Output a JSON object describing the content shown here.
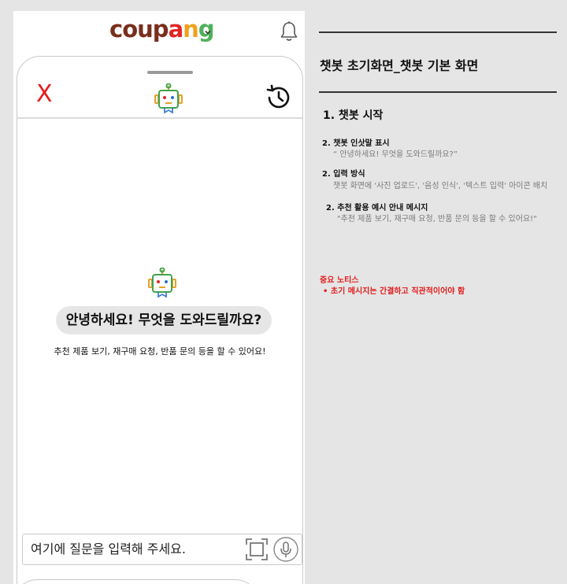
{
  "header": {
    "logo_letters": [
      "c",
      "o",
      "u",
      "p",
      "a",
      "n",
      "g"
    ],
    "logo_colors": [
      "#7a2e1d",
      "#7a2e1d",
      "#7a2e1d",
      "#7a2e1d",
      "#e02525",
      "#f0a01c",
      "#4fb05a"
    ],
    "dropdown_icon": "chevron-down-icon",
    "notification_icon": "bell-icon"
  },
  "chatbot": {
    "close_label": "X",
    "bot_icon": "robot-icon",
    "history_icon": "history-icon",
    "greeting": "안녕하세요! 무엇을 도와드릴까요?",
    "suggestion": "추천 제품 보기, 재구매 요청, 반품 문의 등을 할 수 있어요!",
    "input_placeholder": "여기에 질문을 입력해 주세요.",
    "scan_icon": "scan-icon",
    "mic_icon": "mic-icon"
  },
  "notes": {
    "title": "챗봇 초기화면_챗봇 기본 화면",
    "section_title": "1. 챗봇 시작",
    "items": [
      {
        "heading": "2. 챗봇 인삿말 표시",
        "detail": "“ 안녕하세요! 무엇을 도와드릴까요?”"
      },
      {
        "heading": "2. 입력 방식",
        "detail": "챗봇 화면에 '사진 업로드', '음성 인식', '텍스트 입력' 아이콘 배치"
      },
      {
        "heading": "2.  추천 활용 예시 안내 메시지",
        "detail": "\"추천 제품 보기, 재구매 요청, 반품 문의 등을 할 수 있어요!\""
      }
    ],
    "notice_title": "중요 노티스",
    "notice_bullet": "•  초기 메시지는 간결하고 직관적이어야 함",
    "accent_color": "#e21d1d"
  }
}
